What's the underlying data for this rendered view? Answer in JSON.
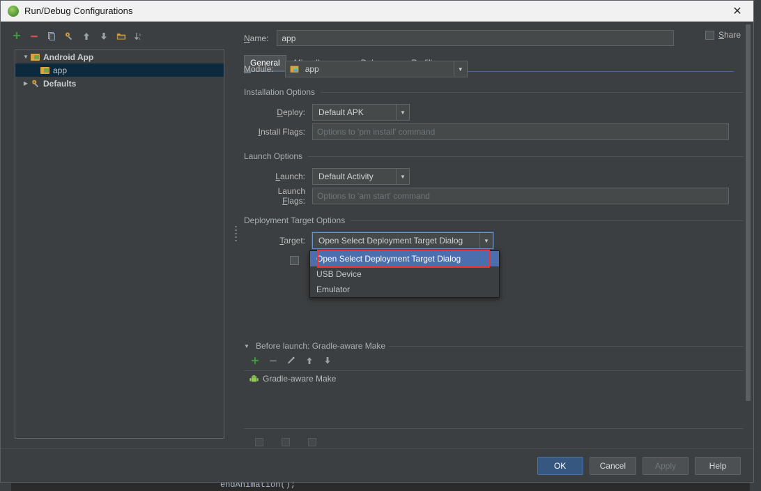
{
  "window": {
    "title": "Run/Debug Configurations",
    "icon": "android-studio-icon",
    "close_label": "✕"
  },
  "background": {
    "editor_code_line": "endAnimation();"
  },
  "tree": {
    "toolbar": [
      {
        "name": "add-configuration-button",
        "glyph": "+"
      },
      {
        "name": "remove-configuration-button",
        "glyph": "−"
      },
      {
        "name": "copy-configuration-button",
        "glyph": "copy-icon"
      },
      {
        "name": "edit-templates-button",
        "glyph": "wrench-icon"
      },
      {
        "name": "move-up-button",
        "glyph": "↑"
      },
      {
        "name": "move-down-button",
        "glyph": "↓"
      },
      {
        "name": "folder-button",
        "glyph": "folder-icon"
      },
      {
        "name": "sort-alphabetically-button",
        "glyph": "sort-icon"
      }
    ],
    "items": [
      {
        "label": "Android App",
        "expanded": true,
        "icon": "android-folder-icon",
        "selected": false
      },
      {
        "label": "app",
        "child": true,
        "icon": "android-folder-icon",
        "selected": true
      },
      {
        "label": "Defaults",
        "expanded": false,
        "icon": "gear-icon",
        "selected": false
      }
    ]
  },
  "name_field": {
    "label": "Name:",
    "value": "app"
  },
  "share": {
    "label": "Share",
    "checked": false
  },
  "tabs": [
    {
      "label": "General",
      "active": true
    },
    {
      "label": "Miscellaneous",
      "active": false
    },
    {
      "label": "Debugger",
      "active": false
    },
    {
      "label": "Profiling",
      "active": false
    }
  ],
  "module": {
    "label": "Module:",
    "value": "app",
    "icon": "android-module-icon"
  },
  "installation_options": {
    "title": "Installation Options",
    "deploy": {
      "label": "Deploy:",
      "value": "Default APK"
    },
    "install_flags": {
      "label": "Install Flags:",
      "placeholder": "Options to 'pm install' command",
      "value": ""
    }
  },
  "launch_options": {
    "title": "Launch Options",
    "launch": {
      "label": "Launch:",
      "value": "Default Activity"
    },
    "launch_flags": {
      "label": "Launch Flags:",
      "placeholder": "Options to 'am start' command",
      "value": ""
    }
  },
  "deployment_target_options": {
    "title": "Deployment Target Options",
    "target": {
      "label": "Target:",
      "value": "Open Select Deployment Target Dialog",
      "open": true,
      "options": [
        {
          "label": "Open Select Deployment Target Dialog",
          "selected": true,
          "highlighted": true
        },
        {
          "label": "USB Device",
          "selected": false,
          "highlighted": false
        },
        {
          "label": "Emulator",
          "selected": false,
          "highlighted": false
        }
      ]
    },
    "highlight_color": "#f3302d",
    "selection_color": "#4b6eaf"
  },
  "before_launch": {
    "title": "Before launch: Gradle-aware Make",
    "toolbar": [
      {
        "name": "add-task-button",
        "glyph": "+"
      },
      {
        "name": "remove-task-button",
        "glyph": "−"
      },
      {
        "name": "edit-task-button",
        "glyph": "pencil-icon"
      },
      {
        "name": "move-task-up-button",
        "glyph": "↑"
      },
      {
        "name": "move-task-down-button",
        "glyph": "↓"
      }
    ],
    "tasks": [
      {
        "label": "Gradle-aware Make",
        "icon": "android-icon"
      }
    ]
  },
  "footer": {
    "ok": "OK",
    "cancel": "Cancel",
    "apply": "Apply",
    "help": "Help"
  }
}
